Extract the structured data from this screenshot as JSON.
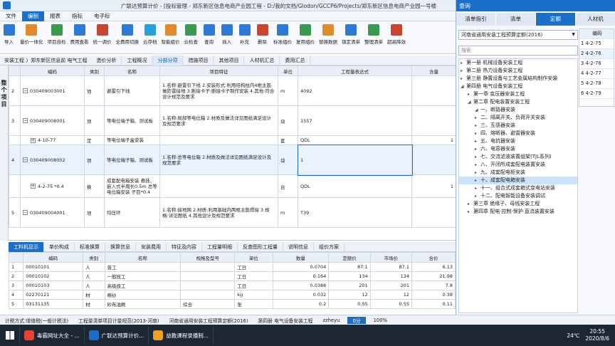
{
  "window_title": "广联达预算计价 - [投标管理 - 郑东新区信息电商产业园工程 - D:/我的文档/Glodon/GCCP6/Projects/郑东新区信息电商产业园一号楼",
  "menu": [
    "文件",
    "编制",
    "报表",
    "指标",
    "电子标"
  ],
  "ribbon": [
    "导入",
    "量价一体化",
    "项目自检",
    "费用查看",
    "统一调价",
    "全费用切换",
    "云存档",
    "智能组价",
    "云检查",
    "查询",
    "插入",
    "补充",
    "删除",
    "标准组价",
    "复用组价",
    "替换数据",
    "锁定清单",
    "整理清单",
    "超高降效"
  ],
  "breadcrumb": "安装工程 〉郑东新区信息前 电气工程",
  "tabs": [
    "造价分析",
    "工程概况",
    "分部分项",
    "措施项目",
    "其他项目",
    "人材机汇总",
    "费用汇总"
  ],
  "left_label": "整个项目",
  "grid": {
    "headers": [
      "",
      "编码",
      "类别",
      "名称",
      "项目特征",
      "单位",
      "工程量表达式",
      "含量"
    ],
    "rows": [
      {
        "no": "2",
        "code": "030409003001",
        "type": "项",
        "name": "避雷引下线",
        "feat": "1.名称:避雷引下线 2.安装形式:利用结构柱内4根主筋做防雷接地 3.断接卡子:断接卡子制作安装 4.其他:符合设计规范及要求",
        "unit": "m",
        "expr": "4092",
        "qty": ""
      },
      {
        "no": "3",
        "code": "030409008001",
        "type": "项",
        "name": "等电位端子箱、测试板",
        "feat": "1.名称:局部等电位箱 2.材质及做法详见图纸满足设计及规范要求",
        "unit": "块",
        "expr": "1557",
        "qty": ""
      },
      {
        "no": "",
        "code": "4-10-77",
        "type": "定",
        "name": "等电位端子盒安装",
        "feat": "",
        "unit": "套",
        "expr": "QDL",
        "qty": "1"
      },
      {
        "no": "4",
        "code": "030409008002",
        "type": "项",
        "name": "等电位端子箱、测试板",
        "feat": "1.名称:总等电位箱 2.材质及做法详见图纸满足设计及规范要求",
        "unit": "块",
        "expr": "1",
        "qty": ""
      },
      {
        "no": "",
        "code": "4-2-75 *0.4",
        "type": "换",
        "name": "成套配电箱安装 悬挂、嵌入式半周长0.5m 总等电位箱安装 子目*0.4",
        "feat": "",
        "unit": "台",
        "expr": "QDL",
        "qty": "1"
      },
      {
        "no": "5",
        "code": "030409004001",
        "type": "项",
        "name": "均压环",
        "feat": "1.名称:接地网 2.材质:利用基础内两根主筋焊接 3.规格:详见图纸 4.其他设计及规范要求",
        "unit": "m",
        "expr": "T39",
        "qty": ""
      }
    ]
  },
  "bottom_tabs": [
    "工料机显示",
    "单价构成",
    "标准换算",
    "换算信息",
    "安装费用",
    "特征及内容",
    "工程量明细",
    "反查图形工程量",
    "说明信息",
    "组价方案"
  ],
  "bottom_grid": {
    "headers": [
      "",
      "编码",
      "类别",
      "名称",
      "规格及型号",
      "单位",
      "数量",
      "定额价",
      "市场价",
      "合价"
    ],
    "rows": [
      [
        "1",
        "00010101",
        "人",
        "普工",
        "",
        "工日",
        "0.0704",
        "87.1",
        "87.1",
        "6.13"
      ],
      [
        "2",
        "00010102",
        "人",
        "一般技工",
        "",
        "工日",
        "0.164",
        "134",
        "134",
        "21.98"
      ],
      [
        "3",
        "00010103",
        "人",
        "高级技工",
        "",
        "工日",
        "0.0388",
        "201",
        "201",
        "7.8"
      ],
      [
        "4",
        "02270121",
        "材",
        "棉纱",
        "",
        "kg",
        "0.032",
        "12",
        "12",
        "0.38"
      ],
      [
        "5",
        "03131135",
        "材",
        "砂布油刷",
        "综合",
        "张",
        "0.2",
        "0.55",
        "0.55",
        "0.11"
      ]
    ]
  },
  "status": [
    "计税方式:增值税(一般计税法)",
    "工程量清单项目计量规范(2013-河南)",
    "河南省通用安装工程预算定额(2016)",
    "第四册 电气设备安装工程",
    "zzheyu",
    "0分",
    "100%"
  ],
  "taskbar": [
    "毒霸网址大全 - ...",
    "广联达预算计价...",
    "益教课程录播制..."
  ],
  "tray": {
    "temp": "24℃",
    "time": "20:55",
    "date": "2020/8/6"
  },
  "panel": {
    "title": "查询",
    "tabs": [
      "清单指引",
      "清单",
      "定额",
      "人材机"
    ],
    "active_tab": 2,
    "select": "河南省通用安装工程预算定额(2016)",
    "search_placeholder": "搜索",
    "tree": [
      {
        "level": 0,
        "text": "第一册 机械设备安装工程",
        "open": false
      },
      {
        "level": 0,
        "text": "第二册 热力设备安装工程",
        "open": false
      },
      {
        "level": 0,
        "text": "第三册 静置设备与工艺金属结构制作安装",
        "open": false
      },
      {
        "level": 0,
        "text": "第四册 电气设备安装工程",
        "open": true
      },
      {
        "level": 1,
        "text": "第一章 变压器安装工程",
        "open": false
      },
      {
        "level": 1,
        "text": "第二章 配电装置安装工程",
        "open": true
      },
      {
        "level": 2,
        "text": "一、断路器安装",
        "open": true
      },
      {
        "level": 2,
        "text": "二、隔离开关、负荷开关安装",
        "open": false
      },
      {
        "level": 2,
        "text": "三、互感器安装",
        "open": false
      },
      {
        "level": 2,
        "text": "四、熔断器、避雷器安装",
        "open": false
      },
      {
        "level": 2,
        "text": "五、电抗器安装",
        "open": false
      },
      {
        "level": 2,
        "text": "六、电容器安装",
        "open": false
      },
      {
        "level": 2,
        "text": "七、交流滤波装置组架(TJL系列)",
        "open": false
      },
      {
        "level": 2,
        "text": "八、开闭所成套配电装置安装",
        "open": false
      },
      {
        "level": 2,
        "text": "九、成套配电柜安装",
        "open": false
      },
      {
        "level": 2,
        "text": "十、成套配电箱安装",
        "open": false,
        "hl": true
      },
      {
        "level": 2,
        "text": "十一、组合式成套箱式变电站安装",
        "open": false
      },
      {
        "level": 2,
        "text": "十二、配电智能设备安装调试",
        "open": false
      },
      {
        "level": 1,
        "text": "第三章 绝缘子、母线安装工程",
        "open": false
      },
      {
        "level": 1,
        "text": "第四章 配电·控制·保护·直流装置安装",
        "open": false
      }
    ],
    "mini_header": "编码",
    "mini": [
      "1 4-2-75",
      "2 4-2-76",
      "3 4-2-76",
      "4 4-2-77",
      "5 4-2-78",
      "6 4-2-79"
    ]
  },
  "colors": {
    "accent": "#1b6fc9"
  }
}
